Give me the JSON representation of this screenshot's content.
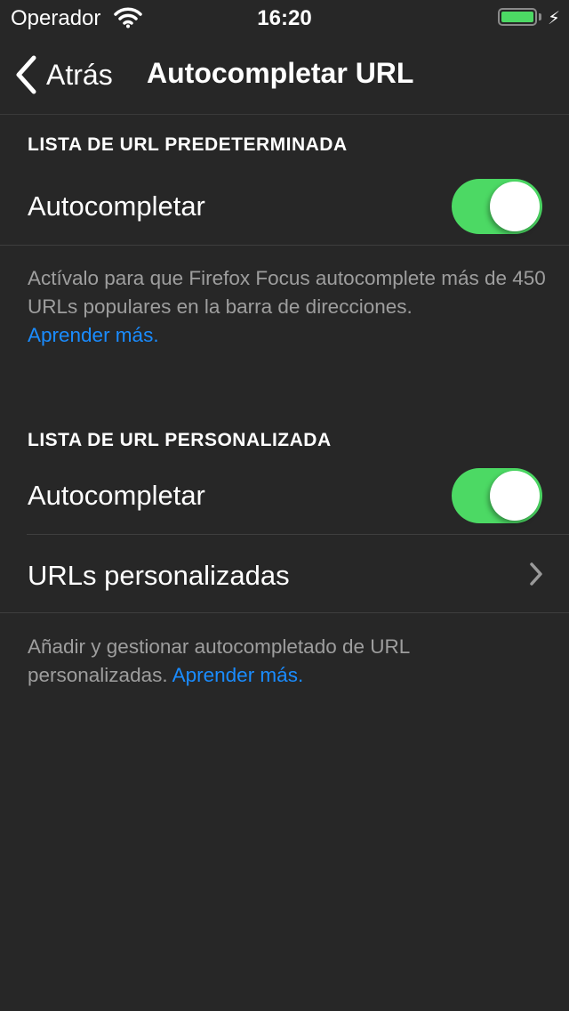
{
  "status_bar": {
    "carrier": "Operador",
    "time": "16:20",
    "battery_level": 1.0,
    "charging": true,
    "icons": [
      "wifi-icon",
      "battery-icon",
      "charging-bolt-icon"
    ]
  },
  "nav": {
    "back_label": "Atrás",
    "title": "Autocompletar URL"
  },
  "sections": [
    {
      "header": "LISTA DE URL PREDETERMINADA",
      "rows": [
        {
          "label": "Autocompletar",
          "toggle_on": true
        }
      ],
      "footer": "Actívalo para que Firefox Focus autocomplete más de 450 URLs populares en la barra de direcciones.",
      "footer_link": "Aprender más."
    },
    {
      "header": "LISTA DE URL PERSONALIZADA",
      "rows": [
        {
          "label": "Autocompletar",
          "toggle_on": true
        },
        {
          "label": "URLs personalizadas",
          "accessory": "chevron-right-icon"
        }
      ],
      "footer": "Añadir y gestionar autocompletado de URL personalizadas.",
      "footer_link": "Aprender más."
    }
  ],
  "colors": {
    "background": "#272727",
    "toggle_on": "#4cd964",
    "link": "#1a8cff",
    "footer_text": "#9e9e9e"
  }
}
